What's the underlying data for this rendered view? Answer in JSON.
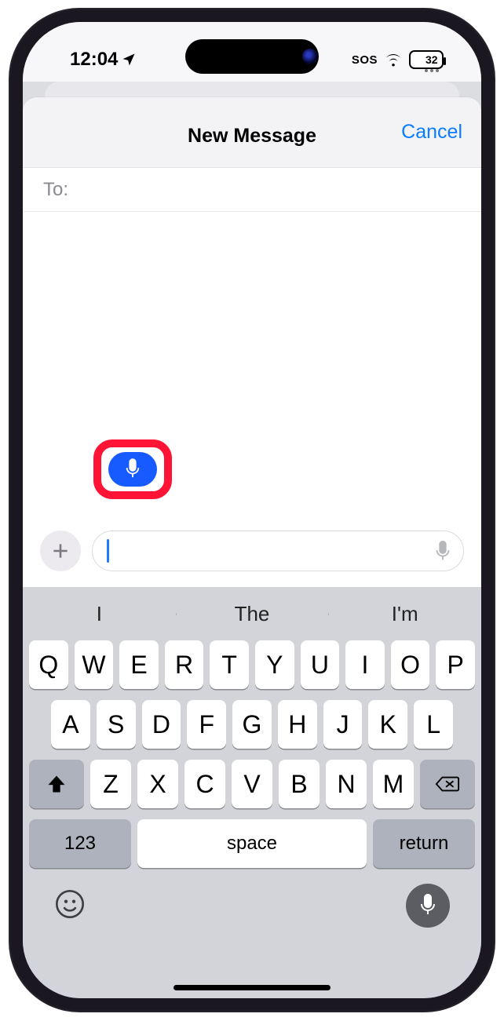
{
  "status": {
    "time": "12:04",
    "sos": "SOS",
    "battery_pct": "32"
  },
  "sheet": {
    "title": "New Message",
    "cancel": "Cancel",
    "to_label": "To:"
  },
  "suggestions": [
    "I",
    "The",
    "I'm"
  ],
  "keyboard": {
    "row1": [
      "Q",
      "W",
      "E",
      "R",
      "T",
      "Y",
      "U",
      "I",
      "O",
      "P"
    ],
    "row2": [
      "A",
      "S",
      "D",
      "F",
      "G",
      "H",
      "J",
      "K",
      "L"
    ],
    "row3": [
      "Z",
      "X",
      "C",
      "V",
      "B",
      "N",
      "M"
    ],
    "numbers": "123",
    "space": "space",
    "return": "return"
  }
}
